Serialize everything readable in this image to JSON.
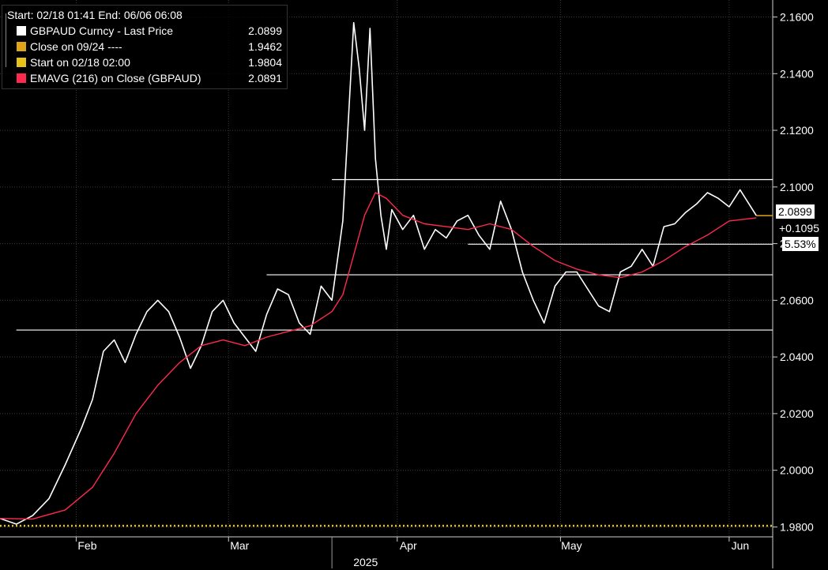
{
  "legend": {
    "header": "Start: 02/18 01:41 End: 06/06 06:08",
    "rows": [
      {
        "label": "GBPAUD Curncy - Last Price",
        "value": "2.0899",
        "color": "#ffffff"
      },
      {
        "label": "Close on 09/24 ----",
        "value": "1.9462",
        "color": "#e0a418"
      },
      {
        "label": "Start on 02/18 02:00",
        "value": "1.9804",
        "color": "#e6c21a"
      },
      {
        "label": "EMAVG (216)  on Close (GBPAUD)",
        "value": "2.0891",
        "color": "#ff2a4d"
      }
    ]
  },
  "flags": {
    "last_price": "2.0899",
    "change": "+0.1095",
    "change_pct": "5.53%"
  },
  "chart_data": {
    "type": "line",
    "title": "",
    "xlabel": "",
    "ylabel": "",
    "x_axis": {
      "year_label": "2025",
      "months": [
        "Feb",
        "Mar",
        "Apr",
        "May",
        "Jun"
      ],
      "month_dates": [
        "2025-02-01",
        "2025-03-01",
        "2025-04-01",
        "2025-05-01",
        "2025-06-01"
      ],
      "range": [
        "2025-01-18",
        "2025-06-09"
      ]
    },
    "y_axis": {
      "ticks": [
        "2.1600",
        "2.1400",
        "2.1200",
        "2.1000",
        "2.0800",
        "2.0600",
        "2.0400",
        "2.0200",
        "2.0000",
        "1.9800"
      ],
      "ylim": [
        1.9765,
        2.166
      ],
      "position": "right"
    },
    "grid": true,
    "series": [
      {
        "name": "GBPAUD Curncy - Last Price",
        "color": "#ffffff",
        "x": [
          "2025-01-18",
          "2025-01-21",
          "2025-01-24",
          "2025-01-27",
          "2025-01-30",
          "2025-02-02",
          "2025-02-04",
          "2025-02-06",
          "2025-02-08",
          "2025-02-10",
          "2025-02-12",
          "2025-02-14",
          "2025-02-16",
          "2025-02-18",
          "2025-02-20",
          "2025-02-22",
          "2025-02-24",
          "2025-02-26",
          "2025-02-28",
          "2025-03-02",
          "2025-03-04",
          "2025-03-06",
          "2025-03-08",
          "2025-03-10",
          "2025-03-12",
          "2025-03-14",
          "2025-03-16",
          "2025-03-18",
          "2025-03-20",
          "2025-03-22",
          "2025-03-24",
          "2025-03-25",
          "2025-03-26",
          "2025-03-27",
          "2025-03-28",
          "2025-03-29",
          "2025-03-30",
          "2025-03-31",
          "2025-04-02",
          "2025-04-04",
          "2025-04-06",
          "2025-04-08",
          "2025-04-10",
          "2025-04-12",
          "2025-04-14",
          "2025-04-16",
          "2025-04-18",
          "2025-04-20",
          "2025-04-22",
          "2025-04-24",
          "2025-04-26",
          "2025-04-28",
          "2025-04-30",
          "2025-05-02",
          "2025-05-04",
          "2025-05-06",
          "2025-05-08",
          "2025-05-10",
          "2025-05-12",
          "2025-05-14",
          "2025-05-16",
          "2025-05-18",
          "2025-05-20",
          "2025-05-22",
          "2025-05-24",
          "2025-05-26",
          "2025-05-28",
          "2025-05-30",
          "2025-06-01",
          "2025-06-03",
          "2025-06-06"
        ],
        "y": [
          1.983,
          1.981,
          1.984,
          1.99,
          2.002,
          2.015,
          2.025,
          2.042,
          2.046,
          2.038,
          2.048,
          2.056,
          2.06,
          2.056,
          2.047,
          2.036,
          2.044,
          2.056,
          2.06,
          2.052,
          2.047,
          2.042,
          2.055,
          2.064,
          2.062,
          2.052,
          2.048,
          2.065,
          2.06,
          2.088,
          2.158,
          2.142,
          2.12,
          2.156,
          2.11,
          2.09,
          2.078,
          2.092,
          2.085,
          2.09,
          2.078,
          2.085,
          2.082,
          2.088,
          2.09,
          2.083,
          2.078,
          2.095,
          2.085,
          2.07,
          2.06,
          2.052,
          2.065,
          2.07,
          2.07,
          2.064,
          2.058,
          2.056,
          2.07,
          2.072,
          2.078,
          2.072,
          2.086,
          2.087,
          2.091,
          2.094,
          2.098,
          2.096,
          2.093,
          2.099,
          2.0899
        ]
      },
      {
        "name": "EMAVG (216)  on Close (GBPAUD)",
        "color": "#ff2a4d",
        "x": [
          "2025-01-18",
          "2025-01-24",
          "2025-01-30",
          "2025-02-04",
          "2025-02-08",
          "2025-02-12",
          "2025-02-16",
          "2025-02-20",
          "2025-02-24",
          "2025-02-28",
          "2025-03-04",
          "2025-03-08",
          "2025-03-12",
          "2025-03-16",
          "2025-03-20",
          "2025-03-22",
          "2025-03-24",
          "2025-03-26",
          "2025-03-28",
          "2025-03-30",
          "2025-04-02",
          "2025-04-06",
          "2025-04-10",
          "2025-04-14",
          "2025-04-18",
          "2025-04-22",
          "2025-04-26",
          "2025-04-30",
          "2025-05-04",
          "2025-05-08",
          "2025-05-12",
          "2025-05-16",
          "2025-05-20",
          "2025-05-24",
          "2025-05-28",
          "2025-06-01",
          "2025-06-06"
        ],
        "y": [
          1.983,
          1.9828,
          1.986,
          1.994,
          2.006,
          2.02,
          2.03,
          2.038,
          2.044,
          2.046,
          2.044,
          2.047,
          2.049,
          2.051,
          2.056,
          2.062,
          2.076,
          2.09,
          2.098,
          2.096,
          2.09,
          2.087,
          2.086,
          2.085,
          2.087,
          2.085,
          2.079,
          2.074,
          2.071,
          2.069,
          2.068,
          2.07,
          2.074,
          2.079,
          2.083,
          2.088,
          2.0891
        ]
      }
    ],
    "reference_lines": {
      "horizontal_levels": [
        2.1026,
        2.0798,
        2.069,
        2.0495
      ],
      "level_starts": [
        "2025-03-20",
        "2025-04-14",
        "2025-03-08",
        "2025-01-21"
      ],
      "start_level": 1.9804,
      "start_color": "#e6c21a"
    }
  }
}
